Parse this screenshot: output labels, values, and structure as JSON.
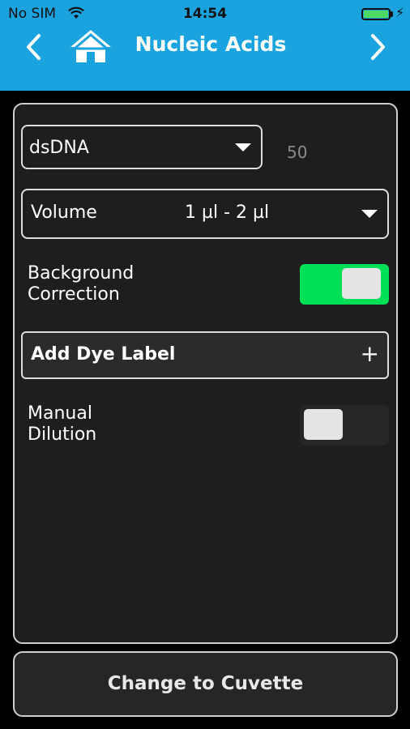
{
  "status_bar": {
    "carrier": "No SIM",
    "time": "14:54",
    "battery_level": 1.0,
    "battery_color": "#4cd964",
    "icons": [
      "wifi-icon",
      "battery-icon",
      "charging-icon"
    ]
  },
  "nav": {
    "title": "Nucleic Acids",
    "back_icon": "chevron-left-icon",
    "home_icon": "home-icon",
    "forward_icon": "chevron-right-icon",
    "background_color": "#1aa3de"
  },
  "settings": {
    "sample_type": {
      "value": "dsDNA",
      "factor": "50"
    },
    "volume": {
      "label": "Volume",
      "value": "1 µl - 2 µl"
    },
    "background_correction": {
      "label_line1": "Background",
      "label_line2": "Correction",
      "on": true,
      "on_color": "#00e056"
    },
    "add_dye": {
      "label": "Add Dye Label",
      "icon": "+"
    },
    "manual_dilution": {
      "label_line1": "Manual",
      "label_line2": "Dilution",
      "on": false
    }
  },
  "footer": {
    "button_label": "Change to Cuvette"
  }
}
